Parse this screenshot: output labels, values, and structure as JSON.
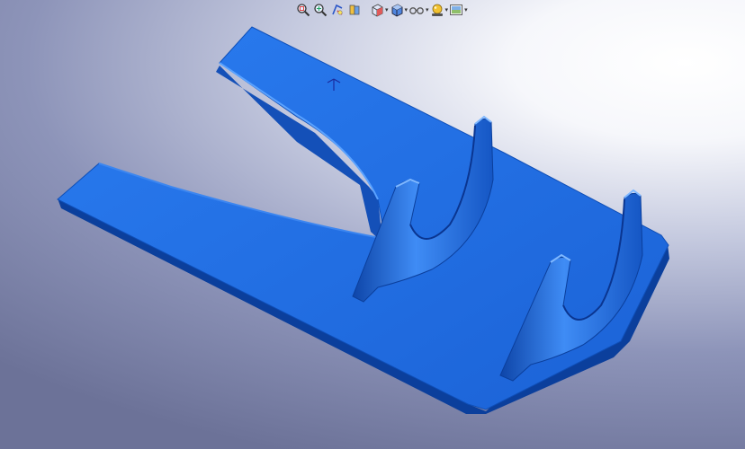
{
  "viewport": {
    "background_center": "#ffffff",
    "background_edge": "#6c7298"
  },
  "toolbar": {
    "buttons": [
      {
        "name": "zoom-to-fit-button",
        "icon": "zoom-fit-icon",
        "dropdown": false
      },
      {
        "name": "zoom-to-area-button",
        "icon": "zoom-area-icon",
        "dropdown": false
      },
      {
        "name": "previous-view-button",
        "icon": "previous-view-icon",
        "dropdown": false
      },
      {
        "name": "section-view-button",
        "icon": "section-view-icon",
        "dropdown": false
      },
      {
        "name": "view-orientation-button",
        "icon": "view-orientation-icon",
        "dropdown": true
      },
      {
        "name": "display-style-button",
        "icon": "display-style-icon",
        "dropdown": true
      },
      {
        "name": "hide-show-items-button",
        "icon": "hide-show-icon",
        "dropdown": true
      },
      {
        "name": "edit-appearance-button",
        "icon": "appearance-icon",
        "dropdown": true
      },
      {
        "name": "apply-scene-button",
        "icon": "scene-icon",
        "dropdown": true
      }
    ]
  },
  "model": {
    "part_color": "#1f6fe0",
    "part_shadow": "#0b3f9c",
    "part_highlight": "#5aa2ff",
    "triad_color": "#1a2c9e"
  }
}
